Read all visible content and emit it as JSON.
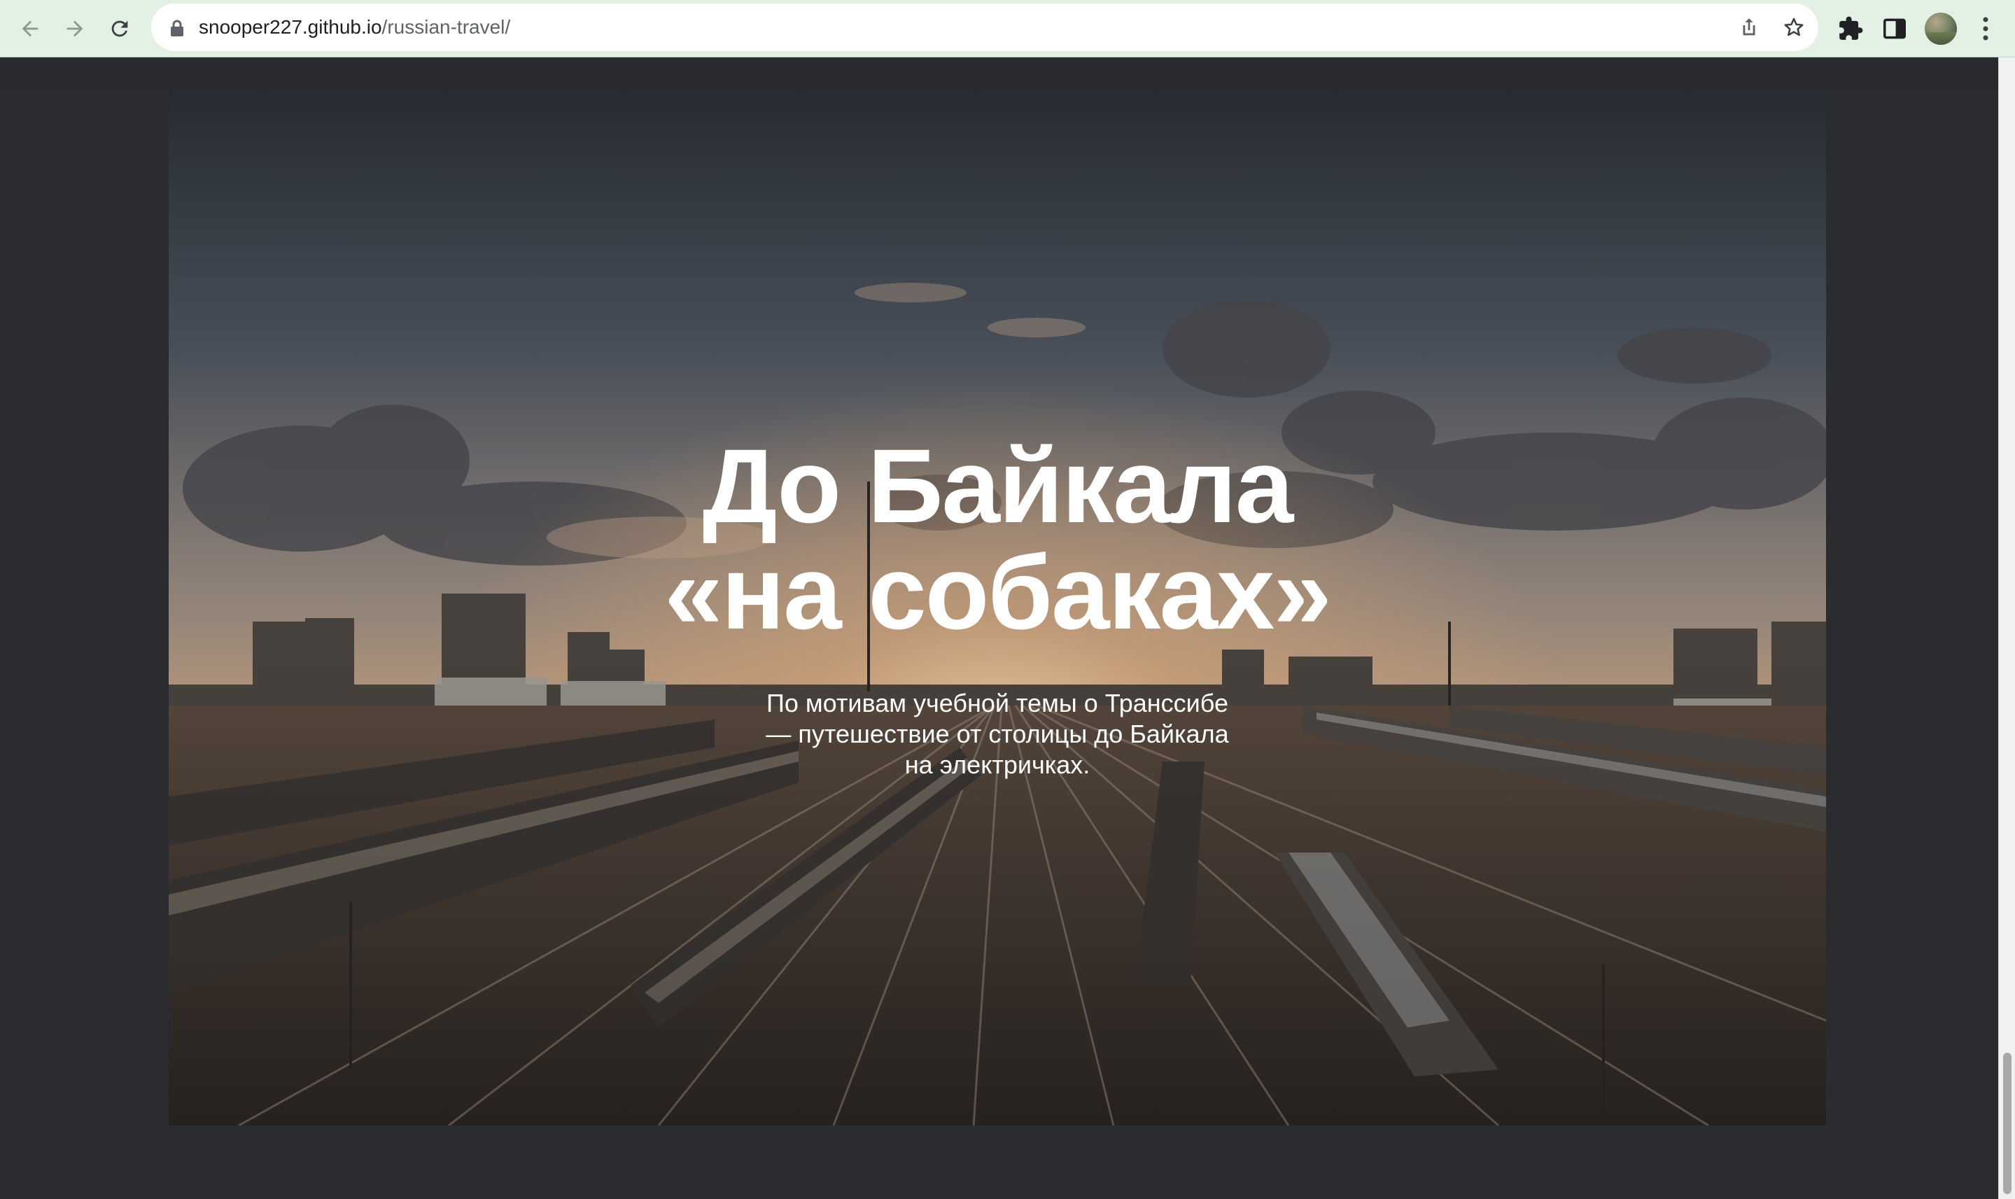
{
  "browser": {
    "url_host": "snooper227.github.io",
    "url_path": "/russian-travel/",
    "icons": {
      "back": "back-arrow-icon",
      "forward": "forward-arrow-icon",
      "reload": "reload-icon",
      "lock": "lock-icon",
      "share": "share-icon",
      "bookmark": "star-icon",
      "extensions": "puzzle-icon",
      "side_panel": "side-panel-icon",
      "profile": "avatar",
      "menu": "kebab-menu-icon"
    },
    "toolbar_color": "#e3f1e4"
  },
  "hero": {
    "title_line1": "До Байкала",
    "title_line2": "«на собаках»",
    "subtitle_line1": "По мотивам учебной темы о Транссибе",
    "subtitle_line2": "— путешествие от столицы до Байкала",
    "subtitle_line3": "на электричках.",
    "image": "sunset-railway-yard-with-freight-trains"
  },
  "colors": {
    "page_background": "#2b2c2f",
    "text": "#ffffff"
  }
}
